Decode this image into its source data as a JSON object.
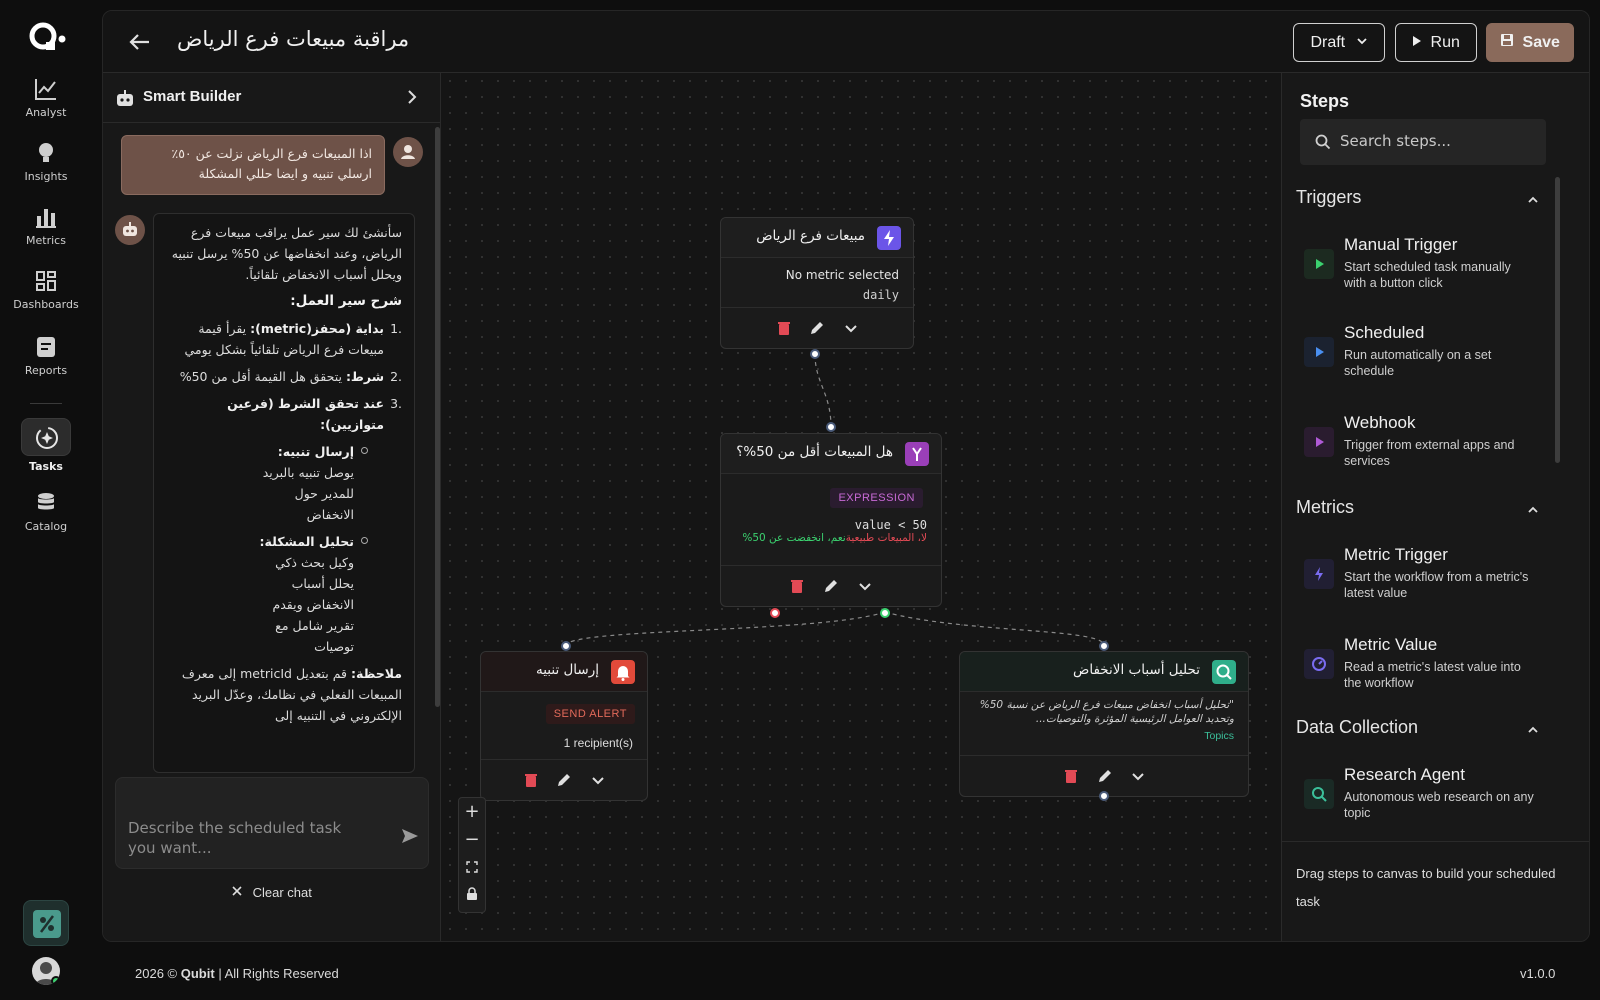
{
  "app": {
    "logo": "Q"
  },
  "rail": {
    "items": [
      {
        "label": "Analyst",
        "icon": "chart-line-icon"
      },
      {
        "label": "Insights",
        "icon": "lightbulb-icon"
      },
      {
        "label": "Metrics",
        "icon": "bar-chart-icon"
      },
      {
        "label": "Dashboards",
        "icon": "dashboard-grid-icon"
      },
      {
        "label": "Reports",
        "icon": "report-icon"
      },
      {
        "label": "Tasks",
        "icon": "tasks-sparkle-icon"
      },
      {
        "label": "Catalog",
        "icon": "database-icon"
      }
    ],
    "active": "Tasks"
  },
  "header": {
    "title": "مراقبة مبيعات فرع الرياض",
    "draft_label": "Draft",
    "run_label": "Run",
    "save_label": "Save"
  },
  "chat": {
    "title": "Smart Builder",
    "user_message": [
      "اذا المبيعات فرع الرياض نزلت عن ٥٠٪",
      "ارسلي تنبيه و ايضا حللي المشكلة"
    ],
    "bot": {
      "intro": "سأنشئ لك سير عمل يراقب مبيعات فرع الرياض، وعند انخفاضها عن 50% يرسل تنبيه ويحلل أسباب الانخفاض تلقائياً.",
      "heading": "شرح سير العمل:",
      "step1_label": "بداية (محفز(metric):",
      "step1_text": "يقرأ قيمة مبيعات فرع الرياض تلقائياً بشكل يومي",
      "step2_label": "شرط:",
      "step2_text": "يتحقق هل القيمة أقل من 50%",
      "step3_label": "عند تحقق الشرط (فرعين متوازيين):",
      "sub1_label": "إرسال تنبيه:",
      "sub1_text": "يوصل تنبيه بالبريد للمدير حول الانخفاض",
      "sub2_label": "تحليل المشكلة:",
      "sub2_text": "وكيل بحث ذكي يحلل أسباب الانخفاض ويقدم تقرير شامل مع توصيات",
      "note_label": "ملاحظة:",
      "note_text": "قم بتعديل metricId إلى معرف المبيعات الفعلي في نظامك، وعدّل البريد الإلكتروني في التنبيه إلى"
    },
    "input_placeholder": "Describe the scheduled task you want...",
    "clear_label": "Clear chat"
  },
  "canvas": {
    "nodes": {
      "trigger": {
        "title": "مبيعات فرع الرياض",
        "line1": "No metric selected",
        "line2": "daily"
      },
      "condition": {
        "title": "هل المبيعات أقل من 50%؟",
        "badge": "EXPRESSION",
        "expr": "value < 50",
        "branch_no": "لا، المبيعات طبيعية",
        "branch_yes": "نعم، انخفضت عن 50%"
      },
      "alert": {
        "title": "إرسال تنبيه",
        "badge": "SEND ALERT",
        "recipients": "1 recipient(s)"
      },
      "analysis": {
        "title": "تحليل أسباب الانخفاض",
        "prompt": "\"تحليل أسباب انخفاض مبيعات فرع الرياض عن نسبة 50% وتحديد العوامل الرئيسية المؤثرة والتوصيات...",
        "tag": "Topics"
      }
    }
  },
  "steps": {
    "title": "Steps",
    "search_placeholder": "Search steps...",
    "sections": [
      {
        "name": "Triggers",
        "items": [
          {
            "title": "Manual Trigger",
            "desc": "Start scheduled task manually with a button click",
            "icon": "play-icon",
            "color": "#3bd16f"
          },
          {
            "title": "Scheduled",
            "desc": "Run automatically on a set schedule",
            "icon": "play-icon",
            "color": "#4a8ff0"
          },
          {
            "title": "Webhook",
            "desc": "Trigger from external apps and services",
            "icon": "play-icon",
            "color": "#b05ad6"
          }
        ]
      },
      {
        "name": "Metrics",
        "items": [
          {
            "title": "Metric Trigger",
            "desc": "Start the workflow from a metric's latest value",
            "icon": "bolt-icon",
            "color": "#7a6cf0"
          },
          {
            "title": "Metric Value",
            "desc": "Read a metric's latest value into the workflow",
            "icon": "gauge-icon",
            "color": "#7a6cf0"
          }
        ]
      },
      {
        "name": "Data Collection",
        "items": [
          {
            "title": "Research Agent",
            "desc": "Autonomous web research on any topic",
            "icon": "search-globe-icon",
            "color": "#3bbf9a"
          }
        ]
      }
    ],
    "drag_hint": "Drag steps to canvas to build your scheduled task"
  },
  "footer": {
    "year": "2026 ©",
    "brand": "Qubit",
    "rights": "| All Rights Reserved",
    "version": "v1.0.0"
  }
}
